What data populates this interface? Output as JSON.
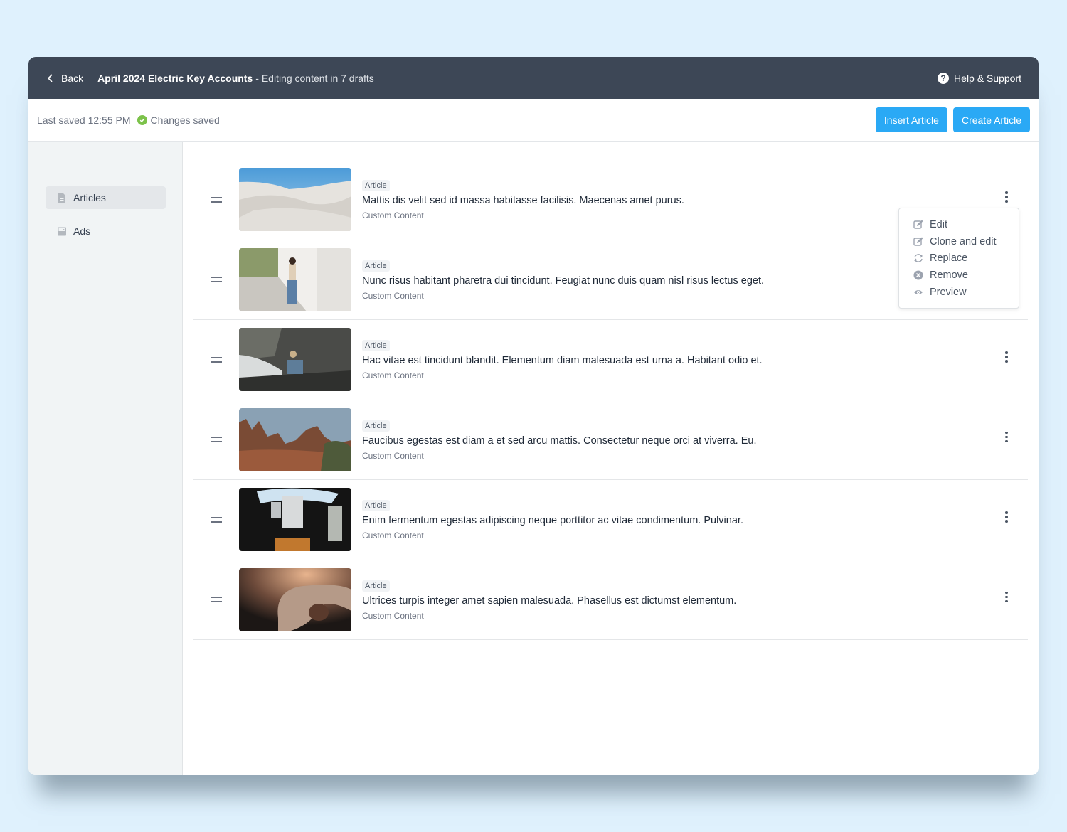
{
  "topbar": {
    "back_label": "Back",
    "title": "April 2024 Electric Key Accounts",
    "subtitle": "- Editing content in 7 drafts",
    "help_label": "Help & Support"
  },
  "savebar": {
    "last_saved": "Last saved 12:55 PM",
    "status": "Changes saved",
    "insert_button": "Insert Article",
    "create_button": "Create Article"
  },
  "colors": {
    "topbar": "#3d4756",
    "accent": "#2aa9f5",
    "success": "#7cc24a",
    "background": "#dff1fd"
  },
  "sidebar": {
    "items": [
      {
        "label": "Articles",
        "icon": "document-icon",
        "active": true
      },
      {
        "label": "Ads",
        "icon": "image-icon",
        "active": false
      }
    ]
  },
  "articles": [
    {
      "badge": "Article",
      "title": "Mattis dis velit sed id massa habitasse facilisis. Maecenas amet purus.",
      "subtitle": "Custom Content",
      "image": "white sand dunes under blue sky"
    },
    {
      "badge": "Article",
      "title": "Nunc risus habitant pharetra dui tincidunt. Feugiat nunc duis quam nisl risus lectus eget.",
      "subtitle": "Custom Content",
      "image": "woman walking on sidewalk holding flowers"
    },
    {
      "badge": "Article",
      "title": "Hac vitae est tincidunt blandit. Elementum diam malesuada est urna a. Habitant odio et.",
      "subtitle": "Custom Content",
      "image": "woman crouching on rocky shore"
    },
    {
      "badge": "Article",
      "title": "Faucibus egestas est diam a et sed arcu mattis. Consectetur neque orci at viverra. Eu.",
      "subtitle": "Custom Content",
      "image": "red rock formations"
    },
    {
      "badge": "Article",
      "title": "Enim fermentum egestas adipiscing neque porttitor ac vitae condimentum. Pulvinar.",
      "subtitle": "Custom Content",
      "image": "satellite in space"
    },
    {
      "badge": "Article",
      "title": "Ultrices turpis integer amet sapien malesuada. Phasellus est dictumst elementum.",
      "subtitle": "Custom Content",
      "image": "abstract close-up organic shape"
    }
  ],
  "context_menu": {
    "open_for_row": 0,
    "items": [
      {
        "label": "Edit",
        "icon": "edit-icon"
      },
      {
        "label": "Clone and edit",
        "icon": "clone-edit-icon"
      },
      {
        "label": "Replace",
        "icon": "refresh-icon"
      },
      {
        "label": "Remove",
        "icon": "remove-circle-icon"
      },
      {
        "label": "Preview",
        "icon": "eye-icon"
      }
    ]
  }
}
